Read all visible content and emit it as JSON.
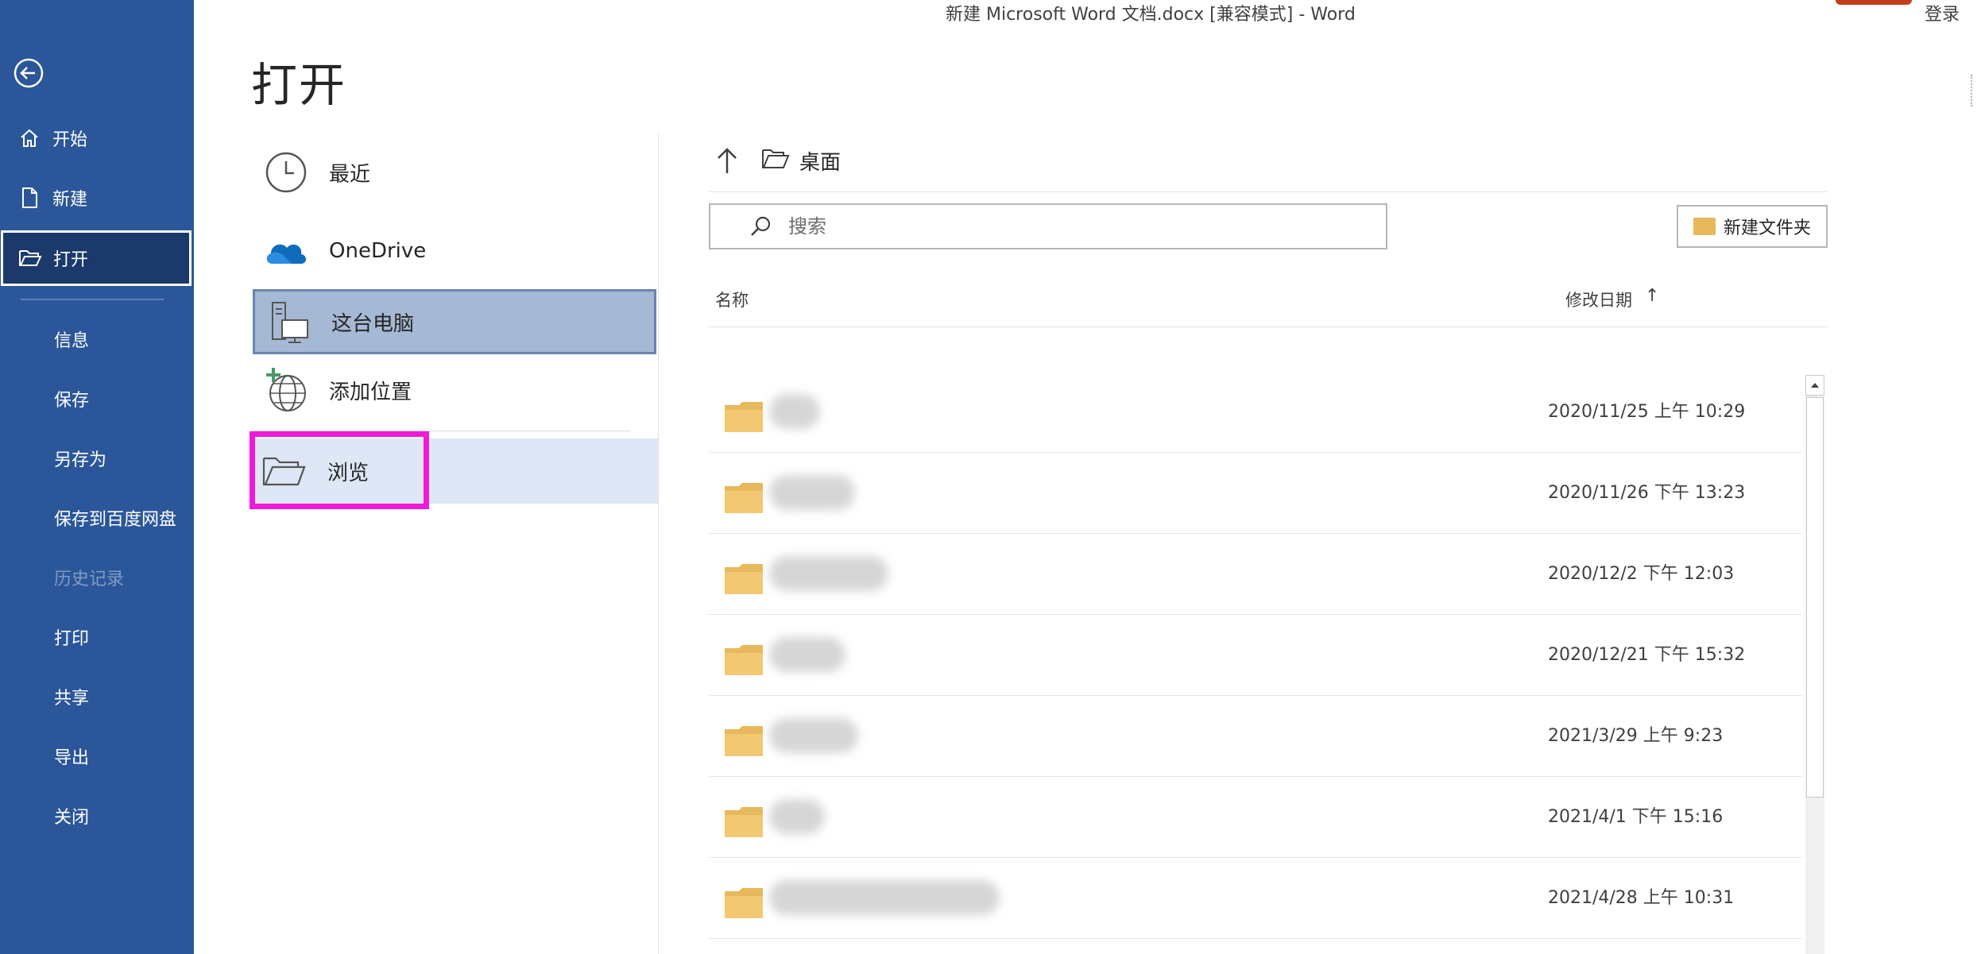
{
  "window": {
    "title": "新建 Microsoft Word 文档.docx [兼容模式]  -  Word",
    "signin": "登录"
  },
  "page_title": "打开",
  "sidebar": {
    "items": [
      {
        "label": "开始",
        "icon": "home-icon"
      },
      {
        "label": "新建",
        "icon": "new-document-icon"
      },
      {
        "label": "打开",
        "icon": "open-folder-icon"
      },
      {
        "label": "信息"
      },
      {
        "label": "保存"
      },
      {
        "label": "另存为"
      },
      {
        "label": "保存到百度网盘"
      },
      {
        "label": "历史记录"
      },
      {
        "label": "打印"
      },
      {
        "label": "共享"
      },
      {
        "label": "导出"
      },
      {
        "label": "关闭"
      }
    ]
  },
  "locations": {
    "items": [
      {
        "label": "最近",
        "icon": "clock-icon"
      },
      {
        "label": "OneDrive",
        "icon": "cloud-icon"
      },
      {
        "label": "这台电脑",
        "icon": "computer-icon"
      },
      {
        "label": "添加位置",
        "icon": "add-location-globe-icon"
      },
      {
        "label": "浏览",
        "icon": "folder-open-icon"
      }
    ]
  },
  "browser": {
    "breadcrumb": "桌面",
    "search_placeholder": "搜索",
    "new_folder_label": "新建文件夹",
    "columns": {
      "name": "名称",
      "modified": "修改日期",
      "sort_indicator": "↑"
    },
    "rows": [
      {
        "modified": "2020/11/25 上午 10:29"
      },
      {
        "modified": "2020/11/26 下午 13:23"
      },
      {
        "modified": "2020/12/2 下午 12:03"
      },
      {
        "modified": "2020/12/21 下午 15:32"
      },
      {
        "modified": "2021/3/29 上午 9:23"
      },
      {
        "modified": "2021/4/1 下午 15:16"
      },
      {
        "modified": "2021/4/28 上午 10:31"
      }
    ]
  },
  "colors": {
    "sidebar": "#2b579a",
    "highlight": "#ee1bd9",
    "folder": "#e8b85c"
  }
}
